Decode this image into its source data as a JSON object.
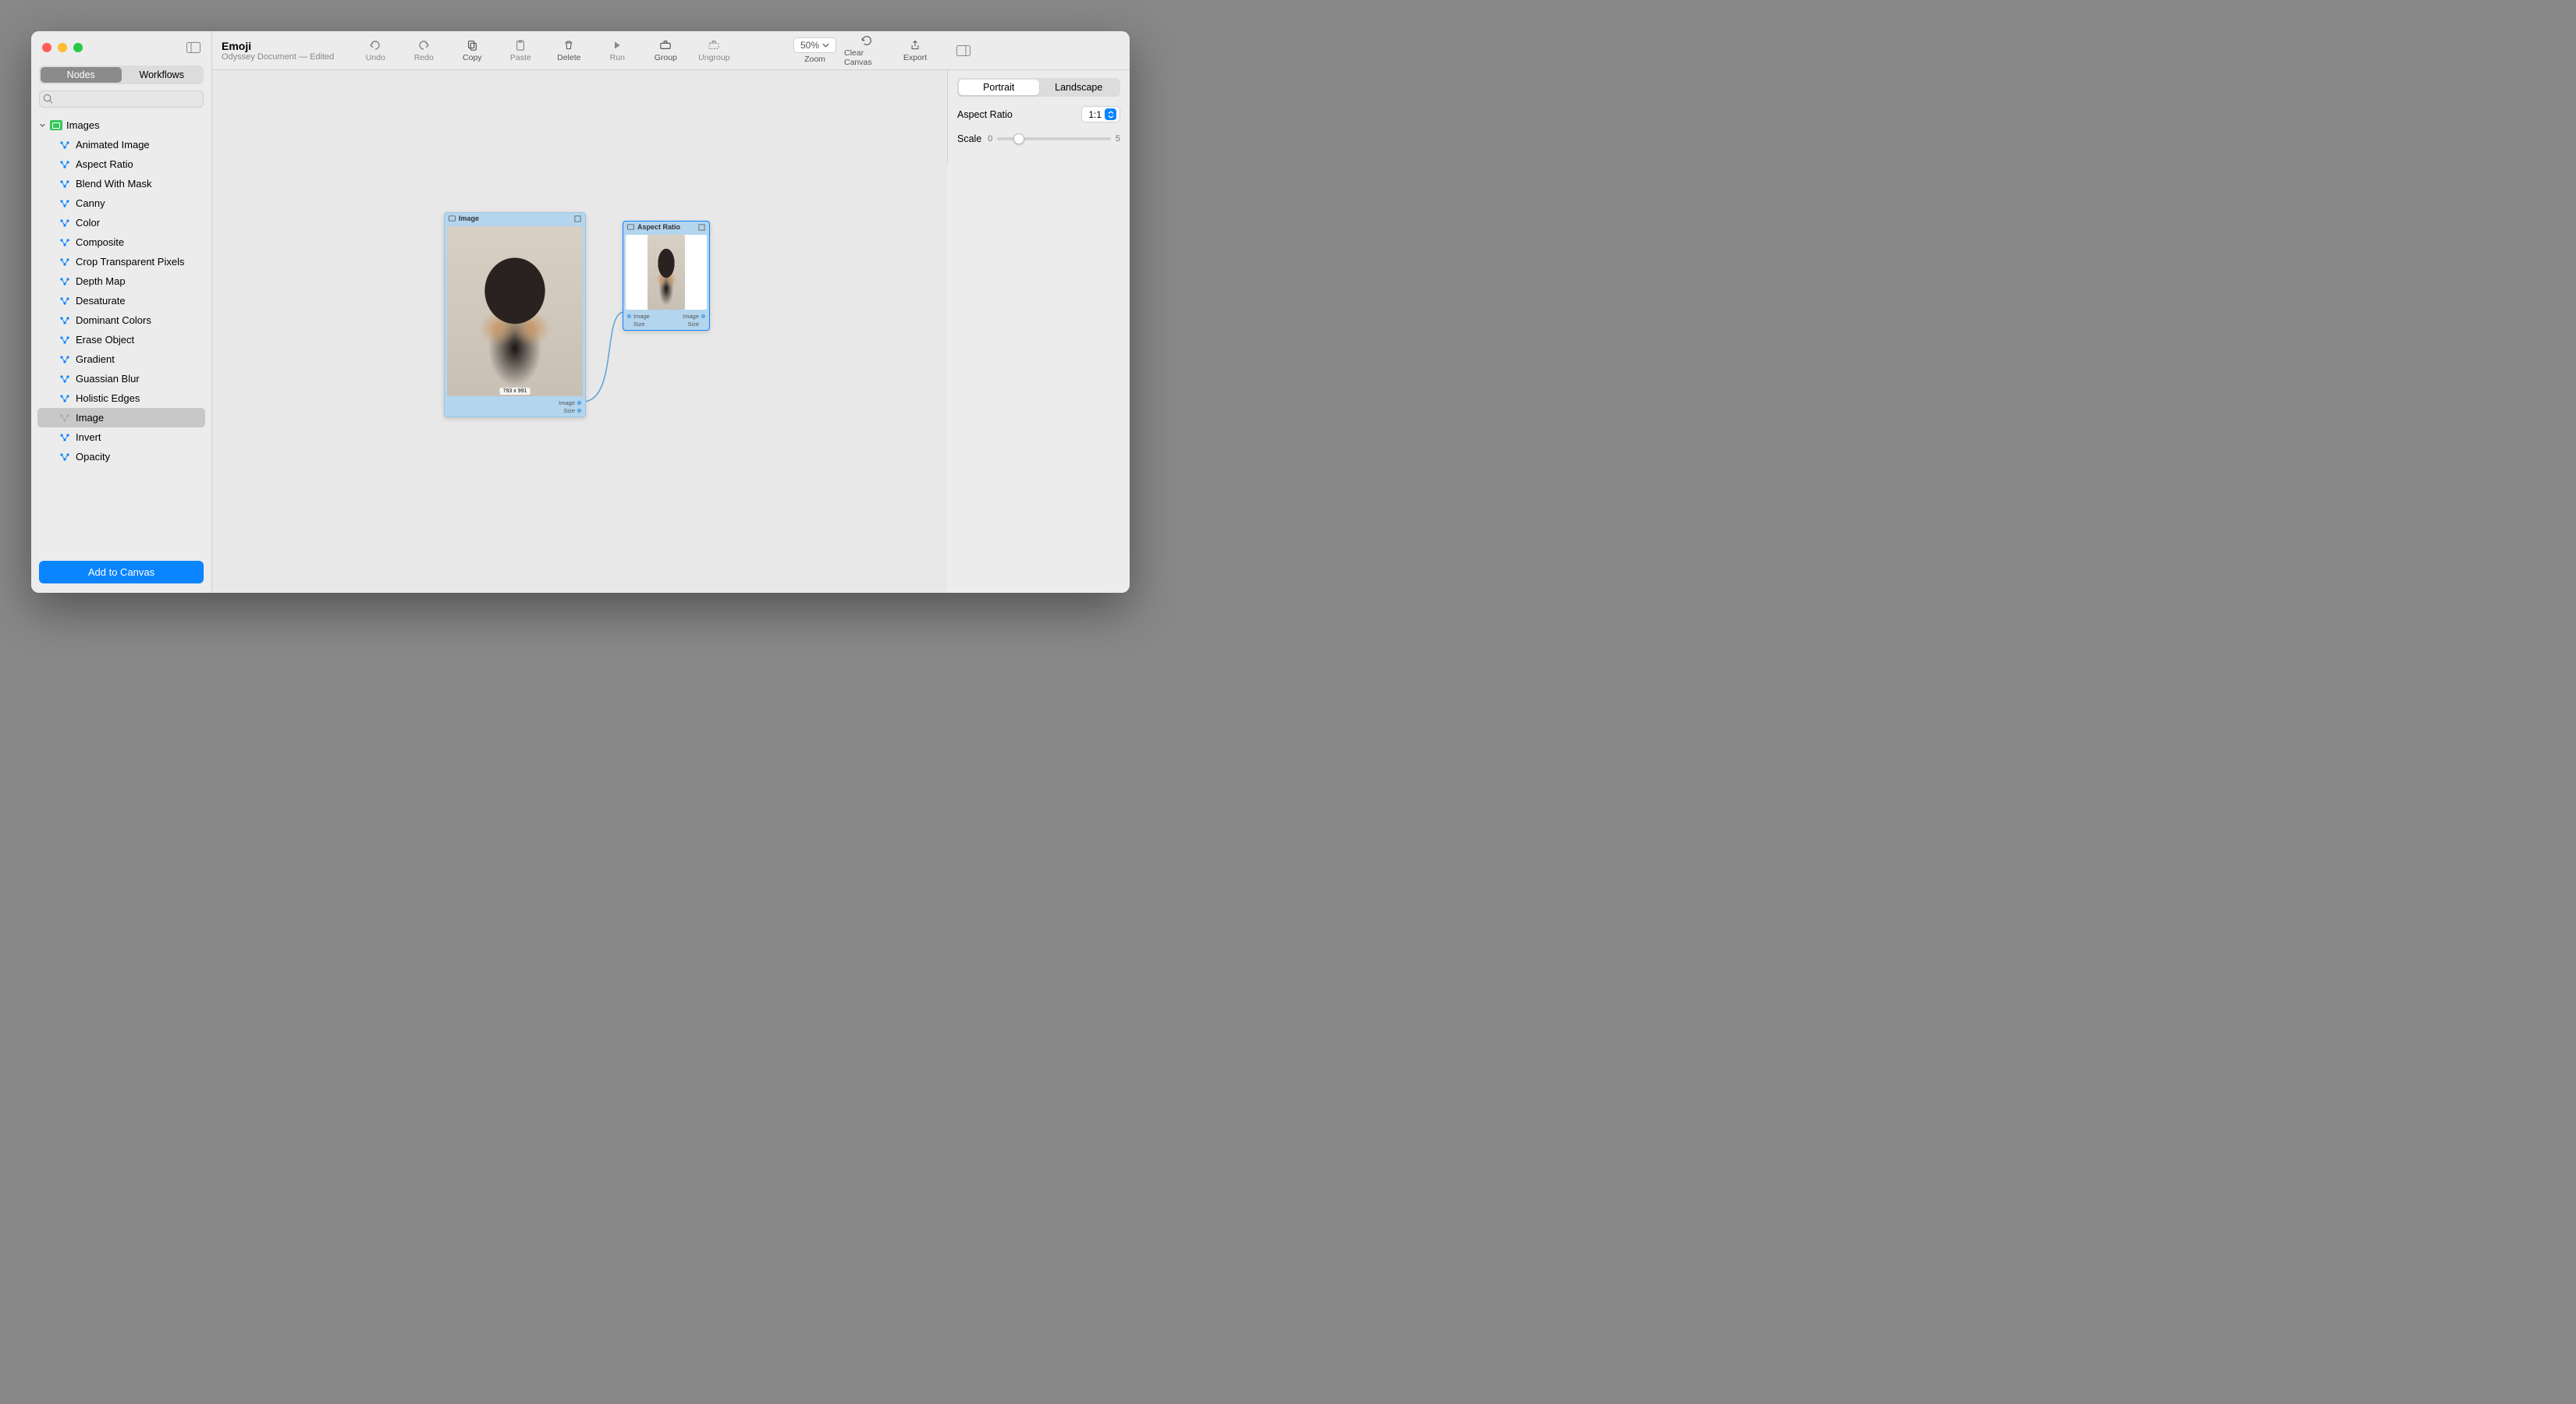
{
  "doc": {
    "title": "Emoji",
    "subtitle": "Odyssey Document — Edited"
  },
  "sidebar": {
    "tabs": {
      "nodes": "Nodes",
      "workflows": "Workflows"
    },
    "search_placeholder": "",
    "group": "Images",
    "items": [
      "Animated Image",
      "Aspect Ratio",
      "Blend With Mask",
      "Canny",
      "Color",
      "Composite",
      "Crop Transparent Pixels",
      "Depth Map",
      "Desaturate",
      "Dominant Colors",
      "Erase Object",
      "Gradient",
      "Guassian Blur",
      "Holistic Edges",
      "Image",
      "Invert",
      "Opacity"
    ],
    "selected_index": 14,
    "add_btn": "Add to Canvas"
  },
  "toolbar": {
    "undo": "Undo",
    "redo": "Redo",
    "copy": "Copy",
    "paste": "Paste",
    "delete": "Delete",
    "run": "Run",
    "group": "Group",
    "ungroup": "Ungroup",
    "zoom_value": "50%",
    "zoom": "Zoom",
    "clear": "Clear Canvas",
    "export": "Export"
  },
  "canvas": {
    "image_node": {
      "title": "Image",
      "dimensions": "793 x 991",
      "out1": "Image",
      "out2": "Size"
    },
    "aspect_node": {
      "title": "Aspect Ratio",
      "in1": "Image",
      "in2": "Size",
      "out1": "Image",
      "out2": "Size"
    }
  },
  "inspector": {
    "portrait": "Portrait",
    "landscape": "Landscape",
    "aspect_label": "Aspect Ratio",
    "aspect_value": "1:1",
    "scale_label": "Scale",
    "scale_min": "0",
    "scale_max": "5"
  }
}
